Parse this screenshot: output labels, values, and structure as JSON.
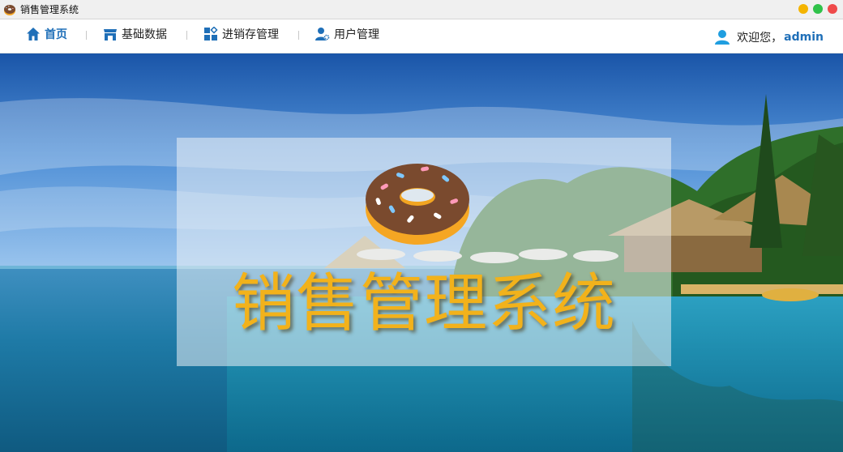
{
  "window": {
    "title": "销售管理系统"
  },
  "nav": {
    "items": [
      {
        "label": "首页",
        "icon": "home-icon",
        "active": true
      },
      {
        "label": "基础数据",
        "icon": "store-icon",
        "active": false
      },
      {
        "label": "进销存管理",
        "icon": "modules-icon",
        "active": false
      },
      {
        "label": "用户管理",
        "icon": "user-gear-icon",
        "active": false
      }
    ],
    "welcome_text": "欢迎您，",
    "username": "admin"
  },
  "banner": {
    "title": "销售管理系统",
    "logo": "donut-icon"
  },
  "colors": {
    "accent": "#1f6fb8",
    "title_yellow": "#f2b21b"
  }
}
